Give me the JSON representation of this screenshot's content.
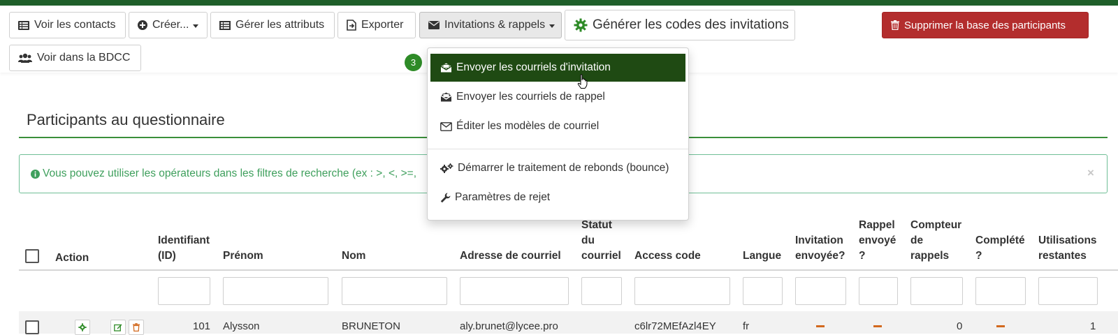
{
  "toolbar": {
    "view_contacts": "Voir les contacts",
    "create": "Créer...",
    "manage_attributes": "Gérer les attributs",
    "export": "Exporter",
    "invitations": "Invitations & rappels",
    "generate_codes": "Générer les codes des invitations",
    "delete_db": "Supprimer la base des participants",
    "view_cpdb": "Voir dans la BDCC"
  },
  "step_badge": "3",
  "dropdown": {
    "items": [
      {
        "label": "Envoyer les courriels d'invitation",
        "icon": "envelope-open-icon"
      },
      {
        "label": "Envoyer les courriels de rappel",
        "icon": "envelope-reminder-icon"
      },
      {
        "label": "Éditer les modèles de courriel",
        "icon": "envelope-outline-icon"
      },
      {
        "label": "Démarrer le traitement de rebonds (bounce)",
        "icon": "cogs-icon"
      },
      {
        "label": "Paramètres de rejet",
        "icon": "wrench-icon"
      }
    ]
  },
  "panel": {
    "title": "Participants au questionnaire",
    "alert": "Vous pouvez utiliser les opérateurs dans les filtres de recherche (ex : >, <, >=,"
  },
  "table": {
    "headers": {
      "action": "Action",
      "id_1": "Identifiant",
      "id_2": "(ID)",
      "firstname": "Prénom",
      "lastname": "Nom",
      "email": "Adresse de courriel",
      "email_status_1": "Statut",
      "email_status_2": "du",
      "email_status_3": "courriel",
      "access_code": "Access code",
      "language": "Langue",
      "invitation_1": "Invitation",
      "invitation_2": "envoyée?",
      "reminder_1": "Rappel",
      "reminder_2": "envoyé",
      "reminder_3": "?",
      "reminder_count_1": "Compteur",
      "reminder_count_2": "de",
      "reminder_count_3": "rappels",
      "completed_1": "Complété",
      "completed_2": "?",
      "uses_1": "Utilisations",
      "uses_2": "restantes"
    },
    "row": {
      "id": "101",
      "firstname": "Alysson",
      "lastname": "BRUNETON",
      "email": "aly.brunet@lycee.pro",
      "access_code": "c6lr72MEfAzl4EY",
      "language": "fr",
      "reminder_count": "0",
      "uses_left": "1"
    }
  },
  "colors": {
    "brand_green": "#1f5f2a",
    "selected_item": "#1f4a13",
    "danger": "#b32d2d",
    "badge": "#2e8b27",
    "alert_text": "#3e9f5c",
    "dash": "#d2691e"
  }
}
